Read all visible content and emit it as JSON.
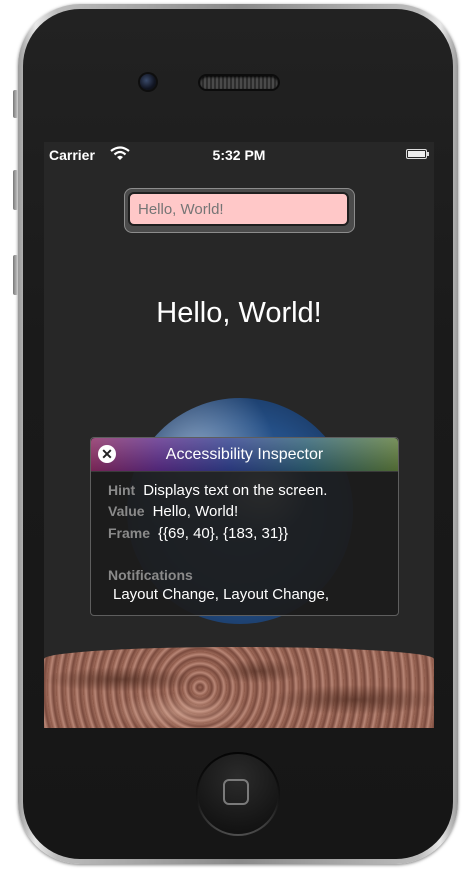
{
  "status_bar": {
    "carrier": "Carrier",
    "time": "5:32 PM",
    "wifi_icon": "wifi-icon",
    "battery_icon": "battery-icon"
  },
  "text_field": {
    "placeholder": "Hello, World!"
  },
  "label": {
    "text": "Hello, World!"
  },
  "inspector": {
    "title": "Accessibility Inspector",
    "close_icon": "close-icon",
    "hint_key": "Hint",
    "hint_value": "Displays text on the screen.",
    "value_key": "Value",
    "value_value": "Hello, World!",
    "frame_key": "Frame",
    "frame_value": "{{69, 40}, {183, 31}}",
    "notifications_key": "Notifications",
    "notifications_value": "Layout Change, Layout Change,"
  },
  "device": {
    "home_button_icon": "home-square-icon"
  },
  "colors": {
    "text_field_background": "#ffc8c8",
    "screen_background": "#272727"
  }
}
